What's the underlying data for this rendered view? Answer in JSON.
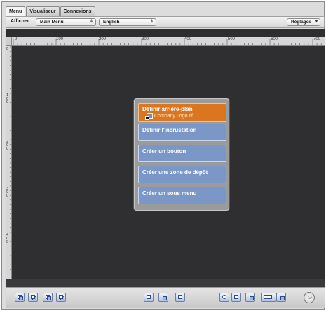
{
  "tabs": [
    {
      "label": "Menu",
      "active": true
    },
    {
      "label": "Visualiseur",
      "active": false
    },
    {
      "label": "Connexions",
      "active": false
    }
  ],
  "toolbar": {
    "afficher_label": "Afficher :",
    "menu_value": "Main Menu",
    "language_value": "English",
    "settings_label": "Réglages"
  },
  "rulers": {
    "horizontal": [
      "0",
      "100",
      "200",
      "300",
      "400",
      "500",
      "600",
      "700"
    ],
    "vertical": [
      "0",
      "100",
      "200",
      "300",
      "400"
    ]
  },
  "menu": {
    "items": [
      {
        "label": "Définir arrière-plan",
        "attachment": "Company Logo.tif",
        "selected": true
      },
      {
        "label": "Définir l'incrustation",
        "selected": false
      },
      {
        "label": "Créer un bouton",
        "selected": false
      },
      {
        "label": "Créer une zone de dépôt",
        "selected": false
      },
      {
        "label": "Créer un sous menu",
        "selected": false
      }
    ]
  },
  "colors": {
    "canvas": "#2f2f31",
    "selected_item": "#d9761f",
    "menu_item": "#7a97c8"
  },
  "bottombar": {
    "grip": "....",
    "record_icon": "person-icon"
  }
}
